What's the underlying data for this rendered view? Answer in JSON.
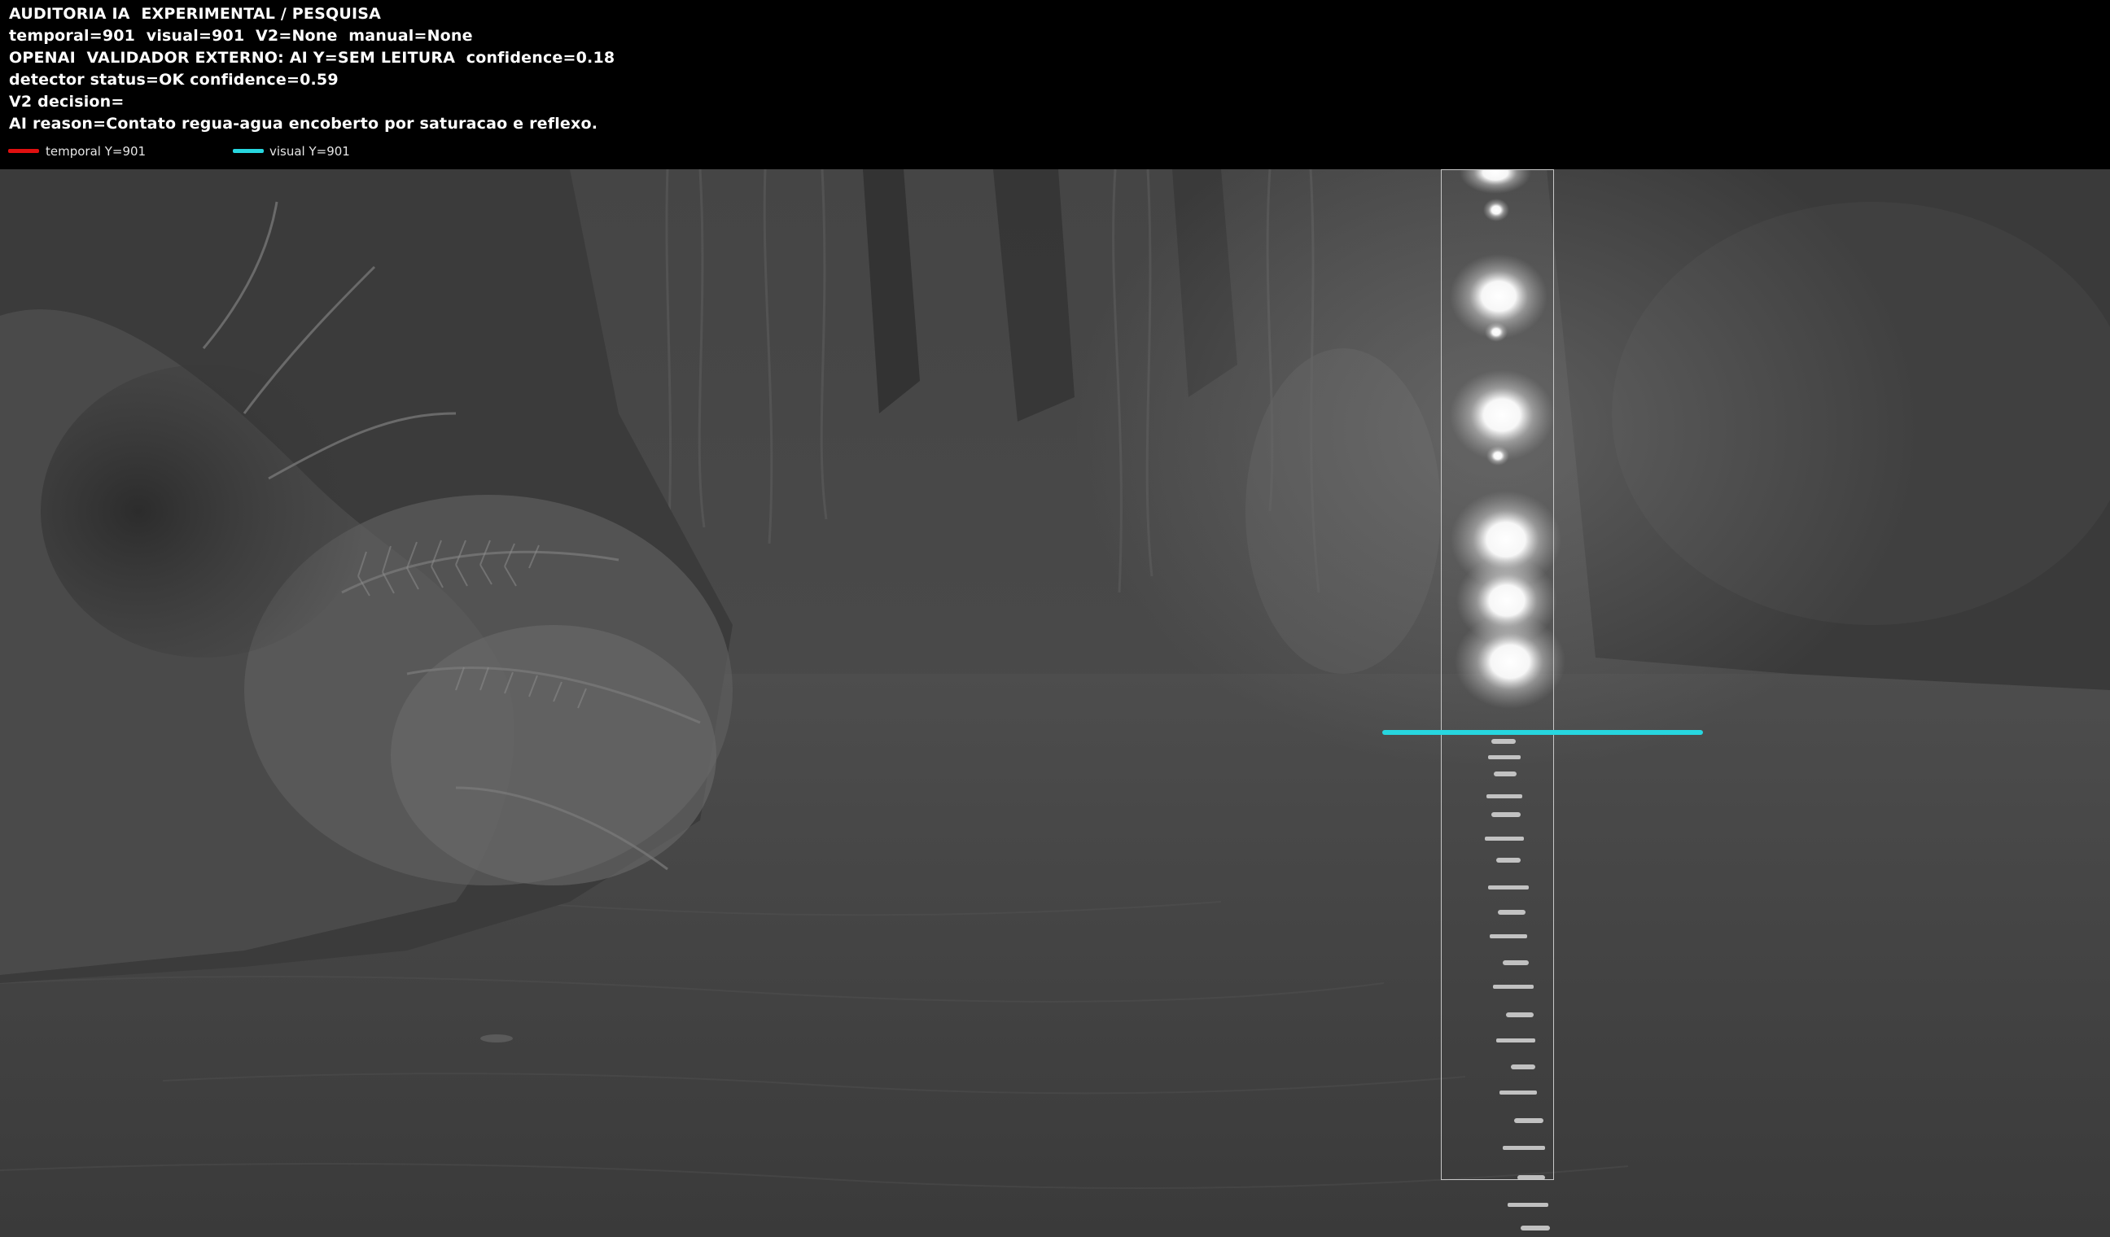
{
  "overlay": {
    "lines": [
      "AUDITORIA IA  EXPERIMENTAL / PESQUISA",
      "temporal=901  visual=901  V2=None  manual=None",
      "OPENAI  VALIDADOR EXTERNO: AI Y=SEM LEITURA  confidence=0.18",
      "detector status=OK confidence=0.59",
      "V2 decision=",
      "AI reason=Contato regua-agua encoberto por saturacao e reflexo."
    ],
    "legend": [
      {
        "label": "temporal Y=901",
        "color": "#e01010"
      },
      {
        "label": "visual Y=901",
        "color": "#27d6df"
      }
    ]
  },
  "colors": {
    "overlay_background": "#000000",
    "overlay_text": "#ffffff",
    "visual_line": "#27d6df",
    "temporal_line": "#e01010",
    "roi_box": "#c8c8c8"
  }
}
